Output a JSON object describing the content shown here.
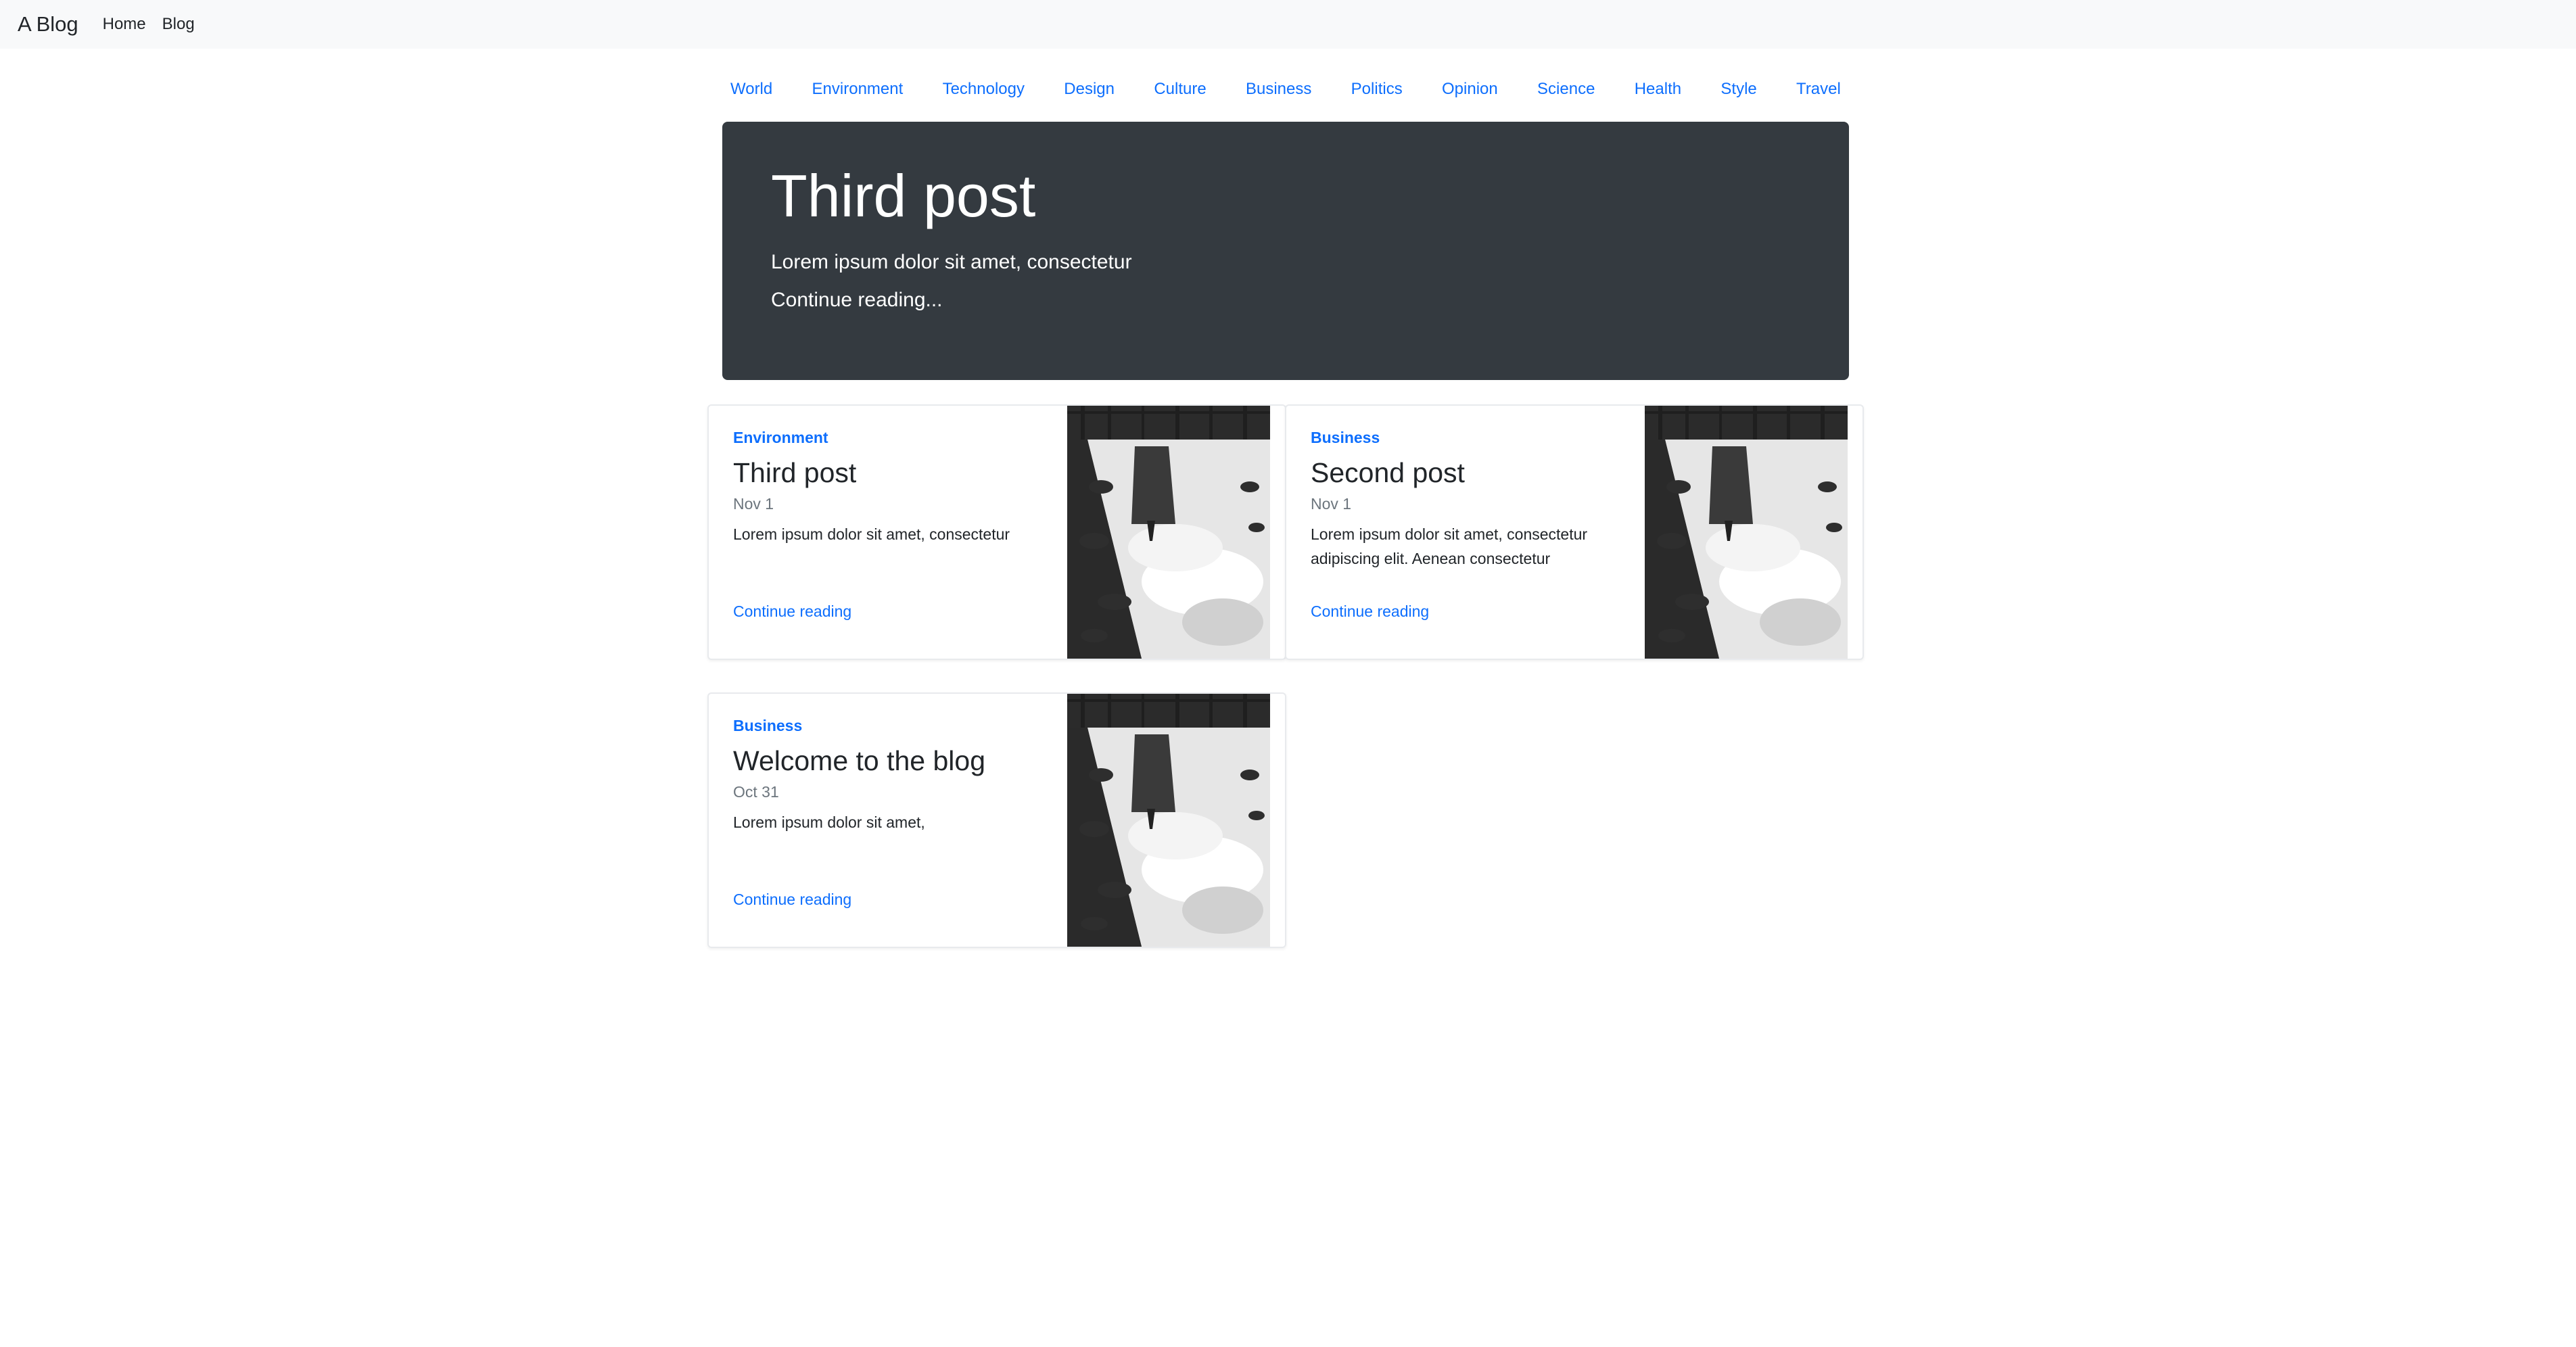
{
  "navbar": {
    "brand": "A Blog",
    "links": [
      "Home",
      "Blog"
    ]
  },
  "categories": [
    "World",
    "Environment",
    "Technology",
    "Design",
    "Culture",
    "Business",
    "Politics",
    "Opinion",
    "Science",
    "Health",
    "Style",
    "Travel"
  ],
  "hero": {
    "title": "Third post",
    "lead": "Lorem ipsum dolor sit amet, consectetur",
    "link": "Continue reading..."
  },
  "posts": [
    {
      "category": "Environment",
      "title": "Third post",
      "date": "Nov 1",
      "excerpt": "Lorem ipsum dolor sit amet, consectetur",
      "link": "Continue reading"
    },
    {
      "category": "Business",
      "title": "Second post",
      "date": "Nov 1",
      "excerpt": "Lorem ipsum dolor sit amet, consectetur adipiscing elit. Aenean consectetur",
      "link": "Continue reading"
    },
    {
      "category": "Business",
      "title": "Welcome to the blog",
      "date": "Oct 31",
      "excerpt": "Lorem ipsum dolor sit amet,",
      "link": "Continue reading"
    }
  ],
  "colors": {
    "link": "#0d6efd",
    "hero_bg": "#343a40",
    "navbar_bg": "#f8f9fa"
  }
}
